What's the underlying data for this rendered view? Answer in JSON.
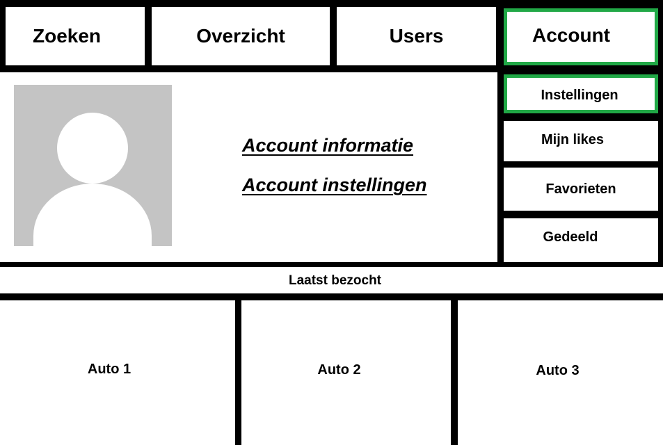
{
  "nav": {
    "tabs": [
      "Zoeken",
      "Overzicht",
      "Users",
      "Account"
    ],
    "active_tab": "Account"
  },
  "account": {
    "links": [
      "Account informatie",
      "Account instellingen"
    ]
  },
  "side_menu": {
    "items": [
      "Instellingen",
      "Mijn likes",
      "Favorieten",
      "Gedeeld"
    ],
    "active_item": "Instellingen"
  },
  "recent": {
    "title": "Laatst bezocht",
    "items": [
      "Auto 1",
      "Auto 2",
      "Auto 3"
    ]
  },
  "colors": {
    "highlight": "#21a846",
    "avatar_placeholder": "#c4c4c4"
  },
  "icons": {
    "avatar": "user-placeholder-icon"
  }
}
